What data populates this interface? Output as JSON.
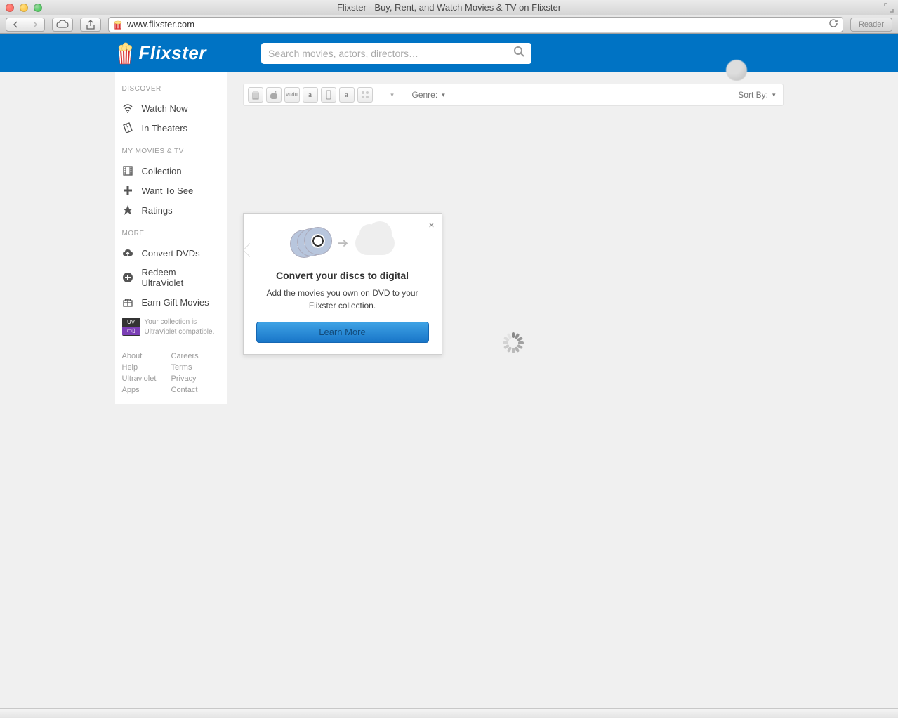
{
  "window": {
    "title": "Flixster - Buy, Rent, and Watch Movies & TV on Flixster",
    "url": "www.flixster.com",
    "reader_label": "Reader"
  },
  "header": {
    "brand": "Flixster",
    "search_placeholder": "Search movies, actors, directors…"
  },
  "sidebar": {
    "sections": {
      "discover_label": "DISCOVER",
      "discover_items": [
        {
          "icon": "wifi-icon",
          "label": "Watch Now"
        },
        {
          "icon": "ticket-icon",
          "label": "In Theaters"
        }
      ],
      "mymovies_label": "MY MOVIES & TV",
      "mymovies_items": [
        {
          "icon": "film-icon",
          "label": "Collection"
        },
        {
          "icon": "plus-icon",
          "label": "Want To See"
        },
        {
          "icon": "star-icon",
          "label": "Ratings"
        }
      ],
      "more_label": "MORE",
      "more_items": [
        {
          "icon": "cloud-up-icon",
          "label": "Convert DVDs"
        },
        {
          "icon": "circle-plus-icon",
          "label": "Redeem UltraViolet"
        },
        {
          "icon": "gift-icon",
          "label": "Earn Gift Movies"
        }
      ]
    },
    "uv_note_line1": "Your collection is",
    "uv_note_line2": "UltraViolet compatible.",
    "footer_left": [
      "About",
      "Help",
      "Ultraviolet",
      "Apps"
    ],
    "footer_right": [
      "Careers",
      "Terms",
      "Privacy",
      "Contact"
    ]
  },
  "filterbar": {
    "genre_label": "Genre:",
    "sortby_label": "Sort By:"
  },
  "popover": {
    "heading": "Convert your discs to digital",
    "body": "Add the movies you own on DVD to your Flixster collection.",
    "button": "Learn More"
  }
}
